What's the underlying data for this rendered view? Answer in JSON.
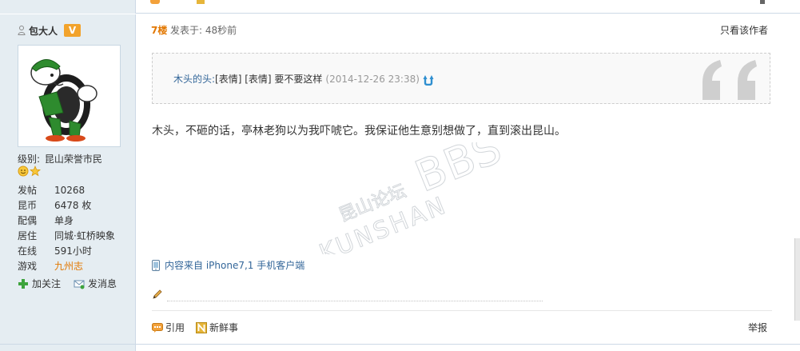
{
  "author": {
    "name": "包大人",
    "badge": "V",
    "level_label": "级别:",
    "level_value": "昆山荣誉市民",
    "stats": [
      {
        "key": "发帖",
        "value": "10268",
        "link": false
      },
      {
        "key": "昆币",
        "value": "6478 枚",
        "link": false
      },
      {
        "key": "配偶",
        "value": "单身",
        "link": false
      },
      {
        "key": "居住",
        "value": "同城·虹桥映象",
        "link": false
      },
      {
        "key": "在线",
        "value": "591小时",
        "link": false
      },
      {
        "key": "游戏",
        "value": "九州志",
        "link": true
      }
    ],
    "follow_label": "加关注",
    "message_label": "发消息"
  },
  "post": {
    "floor": "7楼",
    "posted": "发表于: 48秒前",
    "only_author": "只看该作者",
    "quote": {
      "author": "木头的头:",
      "text": "[表情]  [表情] 要不要这样",
      "date": "(2014-12-26 23:38)"
    },
    "content": "木头，不砸的话，亭林老狗以为我吓唬它。我保证他生意别想做了，直到滚出昆山。",
    "source": "内容来自 iPhone7,1 手机客户端",
    "reply_label": "引用",
    "fresh_label": "新鲜事",
    "report_label": "举报"
  },
  "watermark": {
    "line1": "昆山论坛",
    "line2": "KUNSHAN",
    "line3": "BBS"
  },
  "colors": {
    "accent": "#e27700",
    "link": "#336699",
    "sidebar_bg": "#e5edf2",
    "border": "#cdd9e6"
  },
  "icons": [
    "user-icon",
    "smile-icon",
    "star-icon",
    "plus-icon",
    "message-icon",
    "arrow-up-icon",
    "quote-mark-icon",
    "phone-icon",
    "pencil-icon",
    "reply-icon",
    "fresh-icon"
  ]
}
